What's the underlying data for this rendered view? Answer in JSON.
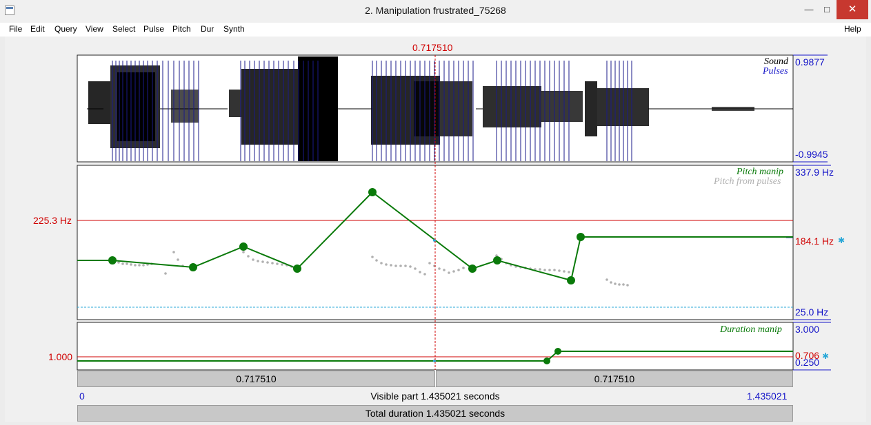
{
  "window": {
    "title": "2. Manipulation frustrated_75268",
    "min": "—",
    "max": "□",
    "close": "✕"
  },
  "menu": {
    "items": [
      "File",
      "Edit",
      "Query",
      "View",
      "Select",
      "Pulse",
      "Pitch",
      "Dur",
      "Synth"
    ],
    "help": "Help"
  },
  "cursor": {
    "time_label": "0.717510"
  },
  "sound": {
    "label": "Sound",
    "pulses_label": "Pulses",
    "max": "0.9877",
    "min": "-0.9945"
  },
  "pitch": {
    "label": "Pitch manip",
    "pulses_label": "Pitch from pulses",
    "top": "337.9 Hz",
    "bottom": "25.0 Hz",
    "cursor_value": "225.3 Hz",
    "right_value": "184.1 Hz"
  },
  "duration": {
    "label": "Duration manip",
    "top": "3.000",
    "bottom": "0.250",
    "cursor_value": "1.000",
    "right_value": "0.706"
  },
  "bars": {
    "left_segment": "0.717510",
    "right_segment": "0.717510",
    "visible_start": "0",
    "visible_part": "Visible part 1.435021 seconds",
    "visible_end": "1.435021",
    "total": "Total duration 1.435021 seconds"
  },
  "colors": {
    "cursor": "#d00000",
    "axis": "#1414c8",
    "manip": "#0a7a0a",
    "pulses": "#b0b0b0",
    "accent": "#2aa8d8"
  }
}
